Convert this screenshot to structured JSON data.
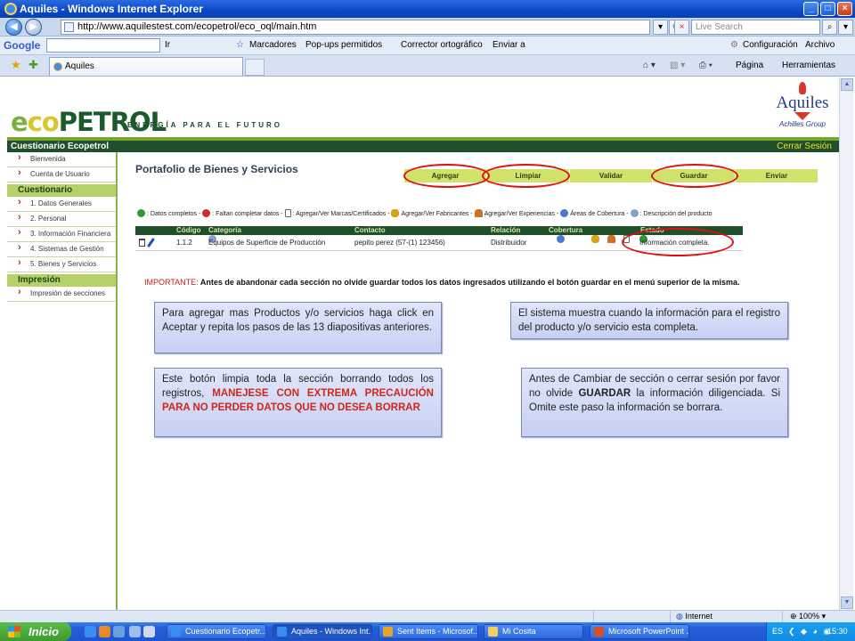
{
  "browser": {
    "window_title": "Aquiles - Windows Internet Explorer",
    "address": "http://www.aquilestest.com/ecopetrol/eco_oql/main.htm",
    "search_placeholder": "Live Search",
    "google_label": "Google",
    "google_toolbar": {
      "go": "Ir",
      "bookmarks": "Marcadores",
      "popups": "Pop-ups permitidos",
      "spell": "Corrector ortográfico",
      "send": "Enviar a",
      "settings": "Configuración",
      "file": "Archivo"
    },
    "tab_title": "Aquiles",
    "command_bar": {
      "page": "Página",
      "tools": "Herramientas"
    },
    "status": {
      "zone": "Internet",
      "zoom": "100%"
    }
  },
  "header": {
    "logo_parts": [
      "e",
      "co",
      "PETROL"
    ],
    "tagline": "ENERGÍA PARA EL FUTURO",
    "partner_logo": "Aquiles",
    "partner_sub": "Achilles Group",
    "nav_title": "Cuestionario Ecopetrol",
    "logout": "Cerrar Sesión"
  },
  "sidebar": {
    "top_items": [
      "Bienvenida",
      "Cuenta de Usuario"
    ],
    "sections": [
      {
        "title": "Cuestionario",
        "items": [
          "1. Datos Generales",
          "2. Personal",
          "3. Información Financiera",
          "4. Sistemas de Gestión",
          "5. Bienes y Servicios"
        ]
      },
      {
        "title": "Impresión",
        "items": [
          "Impresión de secciones"
        ]
      }
    ]
  },
  "main": {
    "title": "Portafolio de Bienes y Servicios",
    "actions": [
      "Agregar",
      "Limpiar",
      "Validar",
      "Guardar",
      "Enviar"
    ],
    "legend": [
      {
        "icon": "check-icon",
        "text": ": Datos completos -"
      },
      {
        "icon": "cross-icon",
        "text": ": Faltan completar datos -"
      },
      {
        "icon": "document-icon",
        "text": ": Agregar/Ver Marcas/Certificados -"
      },
      {
        "icon": "manufacturer-icon",
        "text": "Agregar/Ver Fabricantes -"
      },
      {
        "icon": "experience-icon",
        "text": "Agregar/Ver Experiencias -"
      },
      {
        "icon": "globe-icon",
        "text": "Áreas de Cobertura -"
      },
      {
        "icon": "info-icon",
        "text": ": Descripción del producto"
      }
    ],
    "table": {
      "headers": [
        "Código",
        "Categoría",
        "Contacto",
        "Relación",
        "Cobertura",
        "Estado"
      ],
      "row": {
        "code": "1.1.2",
        "category": "Equipos de Superficie de Producción",
        "contact": "pepito perez (57-(1) 123456)",
        "relation": "Distribuidor",
        "status": "Información completa."
      }
    },
    "important_label": "IMPORTANTE:",
    "important_text": " Antes de abandonar cada sección no olvide guardar todos los datos ingresados utilizando el botón guardar en el menú superior de la misma."
  },
  "callouts": {
    "add": "Para agregar mas Productos y/o servicios haga click en Aceptar y repita los pasos de las 13 diapositivas anteriores.",
    "complete": "El sistema muestra cuando la información para el registro del producto y/o servicio esta completa.",
    "clear_pre": "Este botón limpia toda la sección borrando todos los registros, ",
    "clear_warning": "MANEJESE CON EXTREMA PRECAUCIÓN PARA NO PERDER DATOS QUE NO DESEA BORRAR",
    "save_pre": "Antes de Cambiar de sección o cerrar sesión por favor no olvide ",
    "save_bold": "GUARDAR",
    "save_post": " la información diligenciada. Si Omite este paso la información se borrara."
  },
  "taskbar": {
    "start": "Inicio",
    "tasks": [
      "Cuestionario Ecopetr...",
      "Aquiles - Windows Int...",
      "Sent Items - Microsof...",
      "Mi Cosita",
      "Microsoft PowerPoint ..."
    ],
    "lang": "ES",
    "time": "15:30"
  },
  "colors": {
    "ecopetrol_green": "#1f4f2b",
    "action_lime": "#cfe36a",
    "highlight_ring": "#e01010",
    "callout_blue": "#c6d0f2"
  }
}
